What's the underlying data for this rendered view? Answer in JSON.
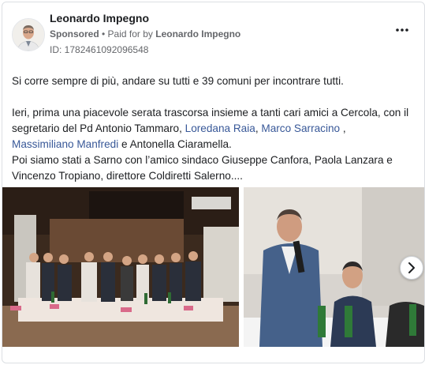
{
  "post": {
    "page_name": "Leonardo Impegno",
    "sponsored_label": "Sponsored",
    "separator": " • ",
    "paid_for_label": "Paid for by ",
    "paid_by": "Leonardo Impegno",
    "library_id": "ID: 1782461092096548",
    "more_icon": "more-horizontal-icon",
    "next_icon": "chevron-right-icon",
    "link_color": "#385898",
    "text": {
      "p1": "Si corre sempre di più, andare su tutti e 39 comuni per incontrare tutti.",
      "p2_a": "Ieri, prima una piacevole serata trascorsa insieme a tanti cari amici a Cercola, con il segretario del Pd Antonio Tammaro, ",
      "link1": "Loredana Raia",
      "sep1": ", ",
      "link2": "Marco Sarracino",
      "sep2": " ,",
      "link3": "Massimiliano Manfredi",
      "p2_b": " e Antonella Ciaramella.",
      "p3": "Poi siamo stati a Sarno con l’amico sindaco Giuseppe Canfora, Paola Lanzara e Vincenzo Tropiano, direttore Coldiretti Salerno...."
    }
  }
}
